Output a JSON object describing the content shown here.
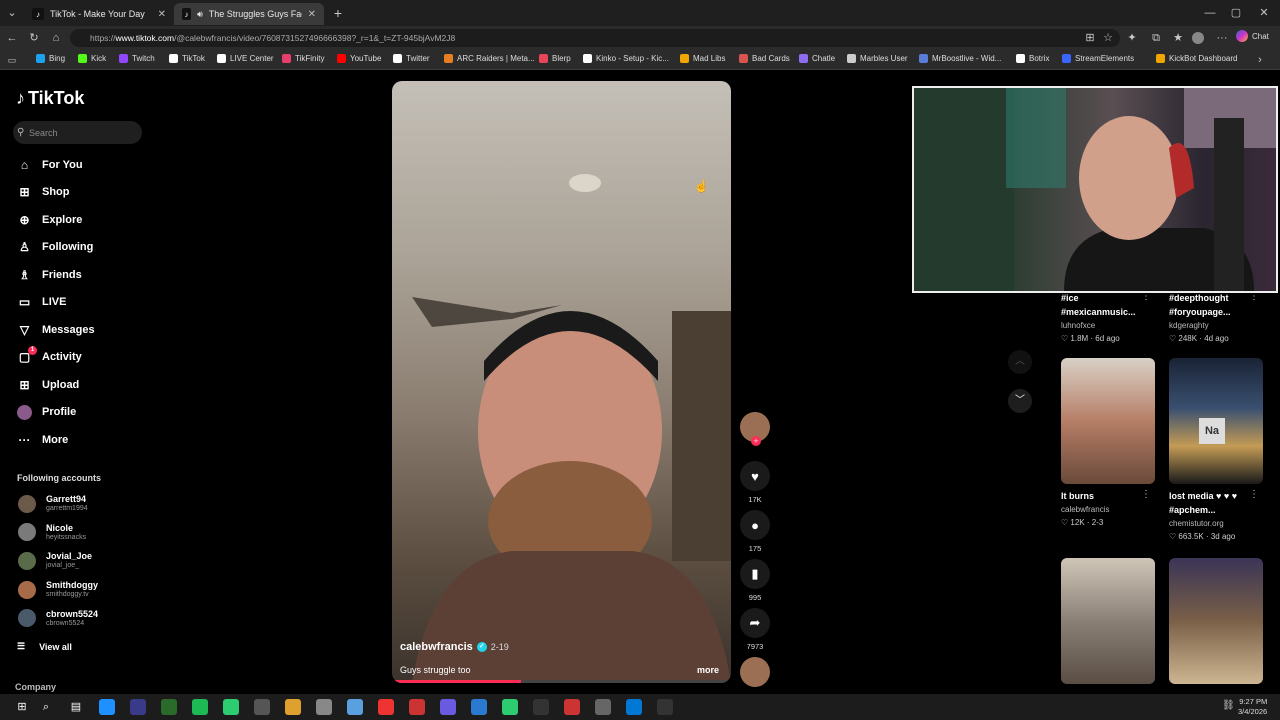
{
  "tabs": [
    {
      "title": "TikTok - Make Your Day"
    },
    {
      "title": "The Struggles Guys Face That"
    }
  ],
  "address": {
    "prefix": "https://",
    "host": "www.tiktok.com",
    "path": "/@calebwfrancis/video/7608731527496666398?_r=1&_t=ZT-945bjAvM2J8"
  },
  "bookmarks": [
    {
      "label": "Bing",
      "color": "#1fa1f1"
    },
    {
      "label": "Kick",
      "color": "#53fc18"
    },
    {
      "label": "Twitch",
      "color": "#9146ff"
    },
    {
      "label": "TikTok",
      "color": "#ffffff"
    },
    {
      "label": "LIVE Center",
      "color": "#ffffff"
    },
    {
      "label": "TikFinity",
      "color": "#e83e6c"
    },
    {
      "label": "YouTube",
      "color": "#ff0000"
    },
    {
      "label": "Twitter",
      "color": "#ffffff"
    },
    {
      "label": "ARC Raiders | Meta...",
      "color": "#e67e22"
    },
    {
      "label": "Blerp",
      "color": "#e8445a"
    },
    {
      "label": "Kinko - Setup - Kic...",
      "color": "#ffffff"
    },
    {
      "label": "Mad Libs",
      "color": "#f0a500"
    },
    {
      "label": "Bad Cards",
      "color": "#d9534f"
    },
    {
      "label": "Chatle",
      "color": "#8e6cf0"
    },
    {
      "label": "Marbles User",
      "color": "#cccccc"
    },
    {
      "label": "MrBoostlive - Wid...",
      "color": "#5a7bd8"
    },
    {
      "label": "Botrix",
      "color": "#ffffff"
    },
    {
      "label": "StreamElements",
      "color": "#3a66ff"
    },
    {
      "label": "KickBot Dashboard",
      "color": "#f0a500"
    }
  ],
  "brand": "TikTok",
  "search_placeholder": "Search",
  "nav": [
    {
      "label": "For You",
      "icon": "home-icon",
      "glyph": "⌂"
    },
    {
      "label": "Shop",
      "icon": "shop-icon",
      "glyph": "⊞"
    },
    {
      "label": "Explore",
      "icon": "explore-icon",
      "glyph": "⊕"
    },
    {
      "label": "Following",
      "icon": "following-icon",
      "glyph": "♙"
    },
    {
      "label": "Friends",
      "icon": "friends-icon",
      "glyph": "♗"
    },
    {
      "label": "LIVE",
      "icon": "live-icon",
      "glyph": "▭"
    },
    {
      "label": "Messages",
      "icon": "messages-icon",
      "glyph": "▽"
    },
    {
      "label": "Activity",
      "icon": "activity-icon",
      "glyph": "▢",
      "badge": "1"
    },
    {
      "label": "Upload",
      "icon": "upload-icon",
      "glyph": "⊞"
    },
    {
      "label": "Profile",
      "icon": "profile-avatar",
      "glyph": "●"
    },
    {
      "label": "More",
      "icon": "more-icon",
      "glyph": "···"
    }
  ],
  "following_title": "Following accounts",
  "following": [
    {
      "name": "Garrett94",
      "handle": "garrettm1994"
    },
    {
      "name": "Nicole",
      "handle": "heyitssnacks"
    },
    {
      "name": "Jovial_Joe",
      "handle": "jovial_joe_"
    },
    {
      "name": "Smithdoggy",
      "handle": "smithdoggy.tv"
    },
    {
      "name": "cbrown5524",
      "handle": "cbrown5524"
    }
  ],
  "view_all": "View all",
  "company": "Company",
  "video": {
    "author": "calebwfrancis",
    "date": "2-19",
    "caption": "Guys struggle too",
    "more": "more"
  },
  "actions": {
    "likes": "17K",
    "comments": "175",
    "saves": "995",
    "shares": "7973"
  },
  "cards": [
    {
      "title": "#ice #mexicanmusic...",
      "user": "luhnofxce",
      "meta": "♡ 1.8M · 6d ago"
    },
    {
      "title": "#deepthought #foryoupage...",
      "user": "kdgeraghty",
      "meta": "♡ 248K · 4d ago"
    },
    {
      "title": "It burns",
      "user": "calebwfrancis",
      "meta": "♡ 12K · 2-3"
    },
    {
      "title": "lost media ♥ ♥ ♥ #apchem...",
      "user": "chemistutor.org",
      "meta": "♡ 663.5K · 3d ago"
    }
  ],
  "clock": {
    "time": "9:27 PM",
    "date": "3/4/2026"
  },
  "chat_label": "Chat"
}
